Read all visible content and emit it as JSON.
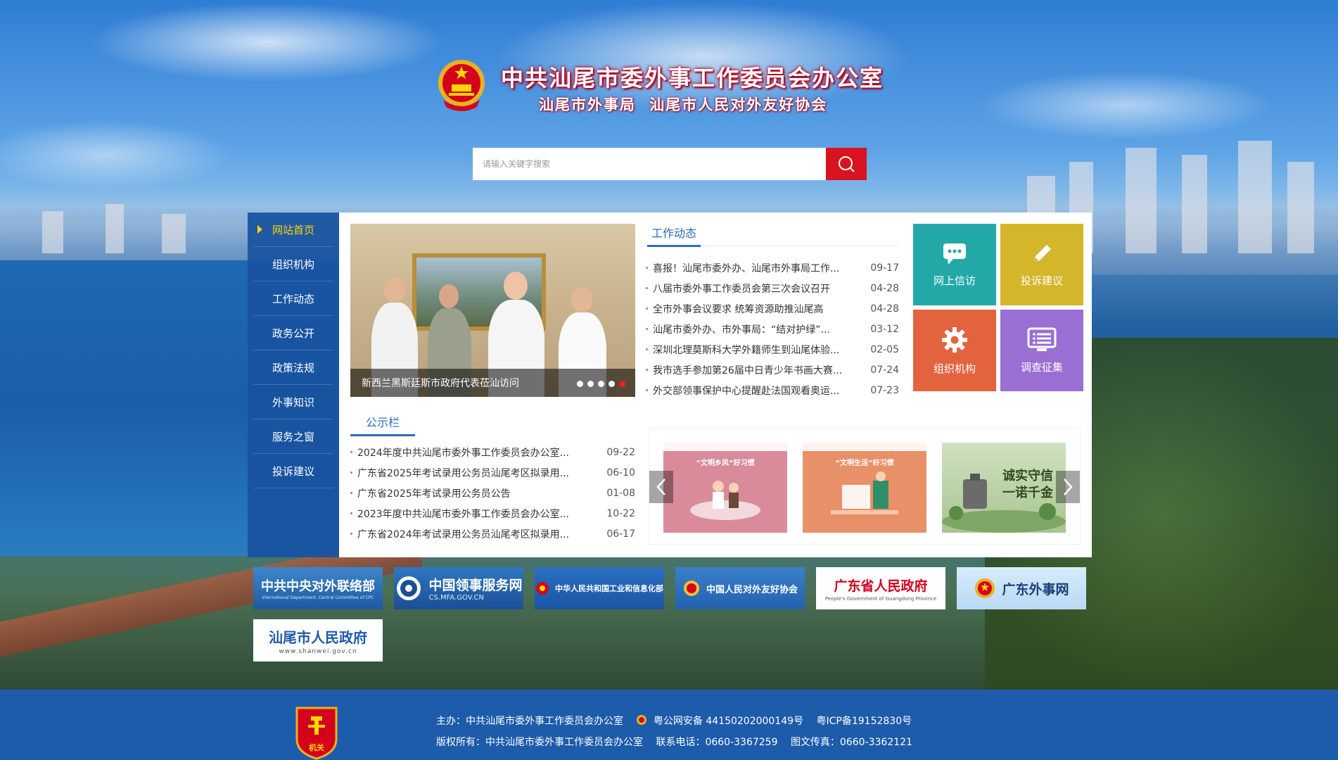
{
  "header": {
    "title": "中共汕尾市委外事工作委员会办公室",
    "subtitle": "汕尾市外事局  汕尾市人民对外友好协会"
  },
  "search": {
    "placeholder": "请输入关键字搜索"
  },
  "sidenav": {
    "items": [
      {
        "label": "网站首页",
        "active": true
      },
      {
        "label": "组织机构"
      },
      {
        "label": "工作动态"
      },
      {
        "label": "政务公开"
      },
      {
        "label": "政策法规"
      },
      {
        "label": "外事知识"
      },
      {
        "label": "服务之窗"
      },
      {
        "label": "投诉建议"
      }
    ]
  },
  "slider": {
    "caption": "新西兰黑斯廷斯市政府代表莅汕访问",
    "dot_count": 5,
    "active_dot": 4
  },
  "work_news": {
    "title": "工作动态",
    "items": [
      {
        "title": "喜报！汕尾市委外办、汕尾市外事局工作...",
        "date": "09-17"
      },
      {
        "title": "八届市委外事工作委员会第三次会议召开",
        "date": "04-28"
      },
      {
        "title": "全市外事会议要求 统筹资源助推汕尾高",
        "date": "04-28"
      },
      {
        "title": "汕尾市委外办、市外事局：“结对护绿”...",
        "date": "03-12"
      },
      {
        "title": "深圳北理莫斯科大学外籍师生到汕尾体验...",
        "date": "02-05"
      },
      {
        "title": "我市选手参加第26届中日青少年书画大赛...",
        "date": "07-24"
      },
      {
        "title": "外交部领事保护中心提醒赴法国观看奥运...",
        "date": "07-23"
      }
    ]
  },
  "tiles": [
    {
      "label": "网上信访",
      "icon": "chat-icon",
      "color": "#23a8a8"
    },
    {
      "label": "投诉建议",
      "icon": "pencil-icon",
      "color": "#d4b62a"
    },
    {
      "label": "组织机构",
      "icon": "gear-icon",
      "color": "#e4633f"
    },
    {
      "label": "调查征集",
      "icon": "list-icon",
      "color": "#9a6fd3"
    }
  ],
  "notice": {
    "title": "公示栏",
    "items": [
      {
        "title": "2024年度中共汕尾市委外事工作委员会办公室...",
        "date": "09-22"
      },
      {
        "title": "广东省2025年考试录用公务员汕尾考区拟录用...",
        "date": "06-10"
      },
      {
        "title": "广东省2025年考试录用公务员公告",
        "date": "01-08"
      },
      {
        "title": "2023年度中共汕尾市委外事工作委员会办公室...",
        "date": "10-22"
      },
      {
        "title": "广东省2024年考试录用公务员汕尾考区拟录用...",
        "date": "06-17"
      }
    ]
  },
  "posters": [
    {
      "label": "“文明乡风”好习惯",
      "style": "pink"
    },
    {
      "label": "“文明生活”好习惯",
      "style": "orange"
    },
    {
      "label": "诚实守信 一诺千金",
      "style": "green"
    }
  ],
  "links": [
    {
      "name": "中共中央对外联络部",
      "sub": "International Department, Central Committee of CPC"
    },
    {
      "name": "中国领事服务网",
      "sub": "CS.MFA.GOV.CN"
    },
    {
      "name": "中华人民共和国工业和信息化部",
      "sub": ""
    },
    {
      "name": "中国人民对外友好协会",
      "sub": ""
    },
    {
      "name": "广东省人民政府",
      "sub": "People's Government of Guangdong Province"
    },
    {
      "name": "广东外事网",
      "sub": ""
    },
    {
      "name": "汕尾市人民政府",
      "sub": "www.shanwei.gov.cn"
    }
  ],
  "footer": {
    "host": "主办：中共汕尾市委外事工作委员会办公室",
    "police": "粤公网安备 44150202000149号",
    "icp": "粤ICP备19152830号",
    "copyright": "版权所有：中共汕尾市委外事工作委员会办公室",
    "phone": "联系电话：0660-3367259",
    "fax": "图文传真：0660-3362121",
    "seal_text": "机关"
  }
}
